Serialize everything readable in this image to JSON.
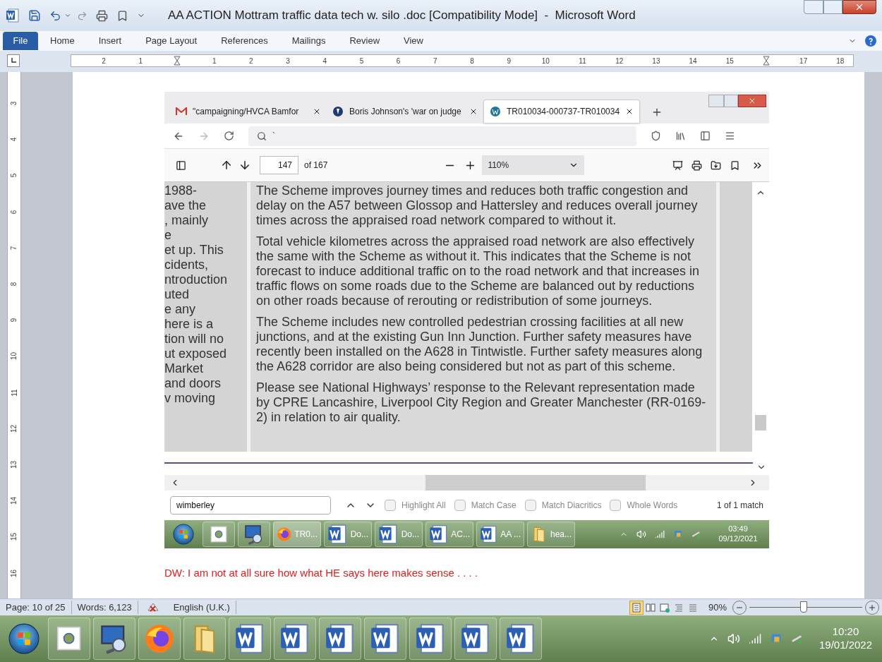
{
  "window": {
    "title": "AA ACTION Mottram traffic data tech w. silo .doc [Compatibility Mode]  -  Microsoft Word"
  },
  "file_button": "File",
  "ribbon_tabs": [
    "Home",
    "Insert",
    "Page Layout",
    "References",
    "Mailings",
    "Review",
    "View"
  ],
  "ruler": [
    {
      "kind": "number",
      "label": "2"
    },
    {
      "kind": "number",
      "label": "1"
    },
    {
      "kind": "marker"
    },
    {
      "kind": "number",
      "label": "1"
    },
    {
      "kind": "number",
      "label": "2"
    },
    {
      "kind": "number",
      "label": "3"
    },
    {
      "kind": "number",
      "label": "4"
    },
    {
      "kind": "number",
      "label": "5"
    },
    {
      "kind": "number",
      "label": "6"
    },
    {
      "kind": "number",
      "label": "7"
    },
    {
      "kind": "number",
      "label": "8"
    },
    {
      "kind": "number",
      "label": "9"
    },
    {
      "kind": "number",
      "label": "10"
    },
    {
      "kind": "number",
      "label": "11"
    },
    {
      "kind": "number",
      "label": "12"
    },
    {
      "kind": "number",
      "label": "13"
    },
    {
      "kind": "number",
      "label": "14"
    },
    {
      "kind": "number",
      "label": "15"
    },
    {
      "kind": "marker"
    },
    {
      "kind": "number",
      "label": "17"
    },
    {
      "kind": "number",
      "label": "18"
    }
  ],
  "vertical_ruler": [
    "3",
    "4",
    "5",
    "6",
    "7",
    "8",
    "9",
    "10",
    "11",
    "12",
    "13",
    "14",
    "15",
    "16"
  ],
  "embedded_screenshot": {
    "browser_tabs": [
      {
        "kind": "mail",
        "title": "\"campaigning/HVCA Bamfor",
        "selected": false
      },
      {
        "kind": "news",
        "title": "Boris Johnson's 'war on judge",
        "selected": false
      },
      {
        "kind": "wordpress",
        "title": "TR010034-000737-TR010034",
        "selected": true
      }
    ],
    "address_bar": {
      "value": "`"
    },
    "pdf_toolbar": {
      "page": "147",
      "page_count": "of 167",
      "zoom": "110%"
    },
    "left_column_lines": [
      "1988-",
      "ave the",
      ", mainly",
      "e",
      "et up. This",
      "cidents,",
      "ntroduction",
      "uted",
      "e any",
      "here is a",
      "tion will no",
      "ut exposed",
      "Market",
      "and doors",
      "v moving"
    ],
    "paragraphs": [
      "The Scheme improves journey times and reduces both traffic congestion and delay on the A57 between Glossop and Hattersley and reduces overall journey times across the appraised road network compared to without it.",
      "Total vehicle kilometres across the appraised road network are also effectively the same with the Scheme as without it. This indicates that the Scheme is not forecast to induce additional traffic on to the road network and that increases in traffic flows on some roads due to the Scheme are balanced out by reductions on other roads because of rerouting or redistribution of some journeys.",
      "The Scheme includes new controlled pedestrian crossing facilities at all new junctions, and at the existing Gun Inn Junction. Further safety measures have recently been installed on the A628 in Tintwistle. Further safety measures along the A628 corridor are also being considered but not as part of this scheme.",
      "Please see National Highways’ response to the Relevant representation made by CPRE Lancashire, Liverpool City Region and Greater Manchester (RR-0169-2) in relation to air quality."
    ],
    "find_bar": {
      "query": "wimberley",
      "options": [
        {
          "label": "Highlight All",
          "checked": false
        },
        {
          "label": "Match Case",
          "checked": false
        },
        {
          "label": "Match Diacritics",
          "checked": false
        },
        {
          "label": "Whole Words",
          "checked": false
        }
      ],
      "result": "1 of 1 match"
    },
    "taskbar": {
      "items": [
        {
          "kind": "start"
        },
        {
          "kind": "app"
        },
        {
          "kind": "explorer"
        },
        {
          "kind": "firefox",
          "label": "TR0...",
          "selected": true
        },
        {
          "kind": "word",
          "label": "Do...",
          "selected": false
        },
        {
          "kind": "word",
          "label": "Do...",
          "selected": false
        },
        {
          "kind": "word",
          "label": "AC...",
          "selected": false
        },
        {
          "kind": "word",
          "label": "AA ...",
          "selected": false
        },
        {
          "kind": "folder",
          "label": "hea...",
          "selected": false
        }
      ],
      "time": "03:49",
      "date": "09/12/2021"
    }
  },
  "note": "DW: I am not at all sure how what HE says here makes sense . . . .",
  "status_bar": {
    "page": "Page: 10 of 25",
    "words": "Words: 6,123",
    "language": "English (U.K.)",
    "view_buttons": [
      {
        "kind": "print",
        "selected": true
      },
      {
        "kind": "reading",
        "selected": false
      },
      {
        "kind": "web",
        "selected": false
      },
      {
        "kind": "outline",
        "selected": false
      },
      {
        "kind": "draft",
        "selected": false
      }
    ],
    "zoom": "90%",
    "zoom_slider": {
      "level": 0.48
    }
  },
  "taskbar": {
    "items": [
      {
        "kind": "start"
      },
      {
        "kind": "app"
      },
      {
        "kind": "explorer"
      },
      {
        "kind": "firefox"
      },
      {
        "kind": "folder"
      },
      {
        "kind": "word"
      },
      {
        "kind": "word"
      },
      {
        "kind": "word"
      },
      {
        "kind": "word"
      },
      {
        "kind": "word"
      },
      {
        "kind": "word"
      },
      {
        "kind": "word"
      }
    ],
    "time": "10:20",
    "date": "19/01/2022"
  }
}
